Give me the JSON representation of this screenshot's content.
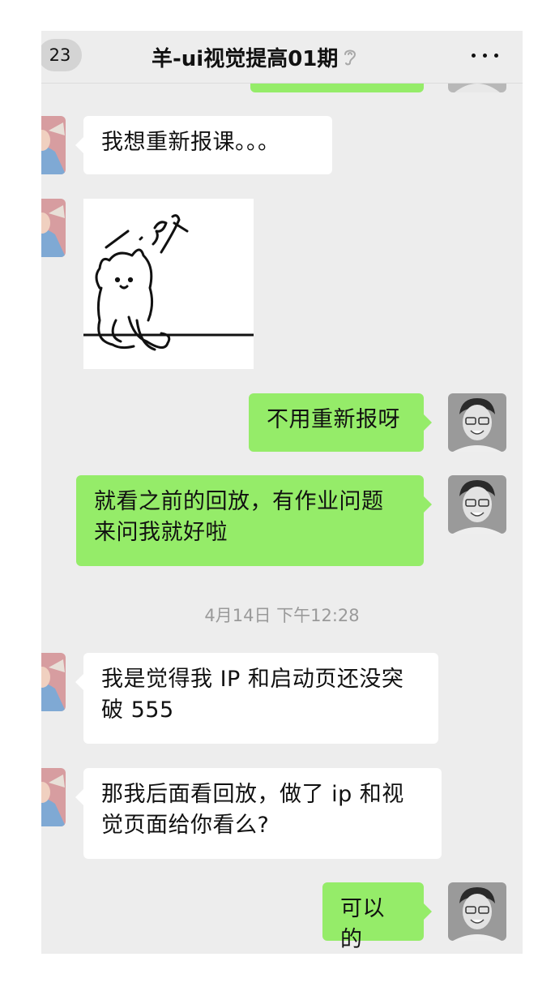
{
  "header": {
    "back_badge": "23",
    "title": "羊-ui视觉提高01期",
    "mute_icon": "ear-muted-icon",
    "more_icon": "more-dots-icon"
  },
  "messages": [
    {
      "side": "left",
      "type": "text",
      "text": "我想重新报课。。。"
    },
    {
      "side": "left",
      "type": "sticker",
      "sticker_icon": "doodle-cat-sticker"
    },
    {
      "side": "right",
      "type": "text",
      "text": "不用重新报呀"
    },
    {
      "side": "right",
      "type": "text",
      "lines": [
        "就看之前的回放，有作业问题",
        "来问我就好啦"
      ]
    },
    {
      "side": "center",
      "type": "timestamp",
      "text": "4月14日 下午12:28"
    },
    {
      "side": "left",
      "type": "text",
      "lines": [
        "我是觉得我 IP 和启动页还没突",
        "破 555"
      ]
    },
    {
      "side": "left",
      "type": "text",
      "lines": [
        "那我后面看回放，做了 ip 和视",
        "觉页面给你看么?"
      ]
    },
    {
      "side": "right",
      "type": "text",
      "text": "可以的"
    }
  ],
  "colors": {
    "chat_background": "#ededed",
    "bubble_self": "#95ec69",
    "bubble_other": "#ffffff",
    "timestamp_text": "#9a9a9a"
  }
}
